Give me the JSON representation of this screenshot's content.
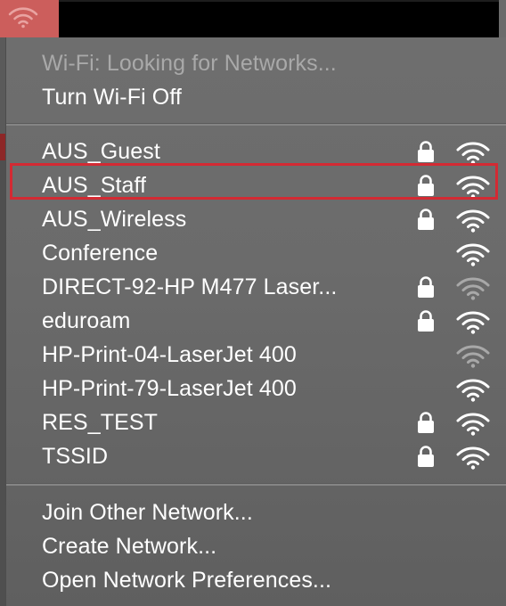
{
  "colors": {
    "menubar_active": "#cc5e5c",
    "menu_text": "#ffffff",
    "disabled_text": "#a9a9a9",
    "highlight_border": "#d32a33",
    "weak_signal": "#a8a8a8"
  },
  "menubar": {
    "wifi_icon": "wifi-icon"
  },
  "status": {
    "text": "Wi-Fi: Looking for Networks..."
  },
  "actions_top": [
    {
      "label": "Turn Wi-Fi Off"
    }
  ],
  "networks": [
    {
      "ssid": "AUS_Guest",
      "secured": true,
      "signal": "strong",
      "highlighted": false
    },
    {
      "ssid": "AUS_Staff",
      "secured": true,
      "signal": "strong",
      "highlighted": false
    },
    {
      "ssid": "AUS_Wireless",
      "secured": true,
      "signal": "strong",
      "highlighted": true
    },
    {
      "ssid": "Conference",
      "secured": false,
      "signal": "strong",
      "highlighted": false
    },
    {
      "ssid": "DIRECT-92-HP M477 Laser...",
      "secured": true,
      "signal": "weak",
      "highlighted": false
    },
    {
      "ssid": "eduroam",
      "secured": true,
      "signal": "strong",
      "highlighted": false
    },
    {
      "ssid": "HP-Print-04-LaserJet 400",
      "secured": false,
      "signal": "weak",
      "highlighted": false
    },
    {
      "ssid": "HP-Print-79-LaserJet 400",
      "secured": false,
      "signal": "strong",
      "highlighted": false
    },
    {
      "ssid": "RES_TEST",
      "secured": true,
      "signal": "strong",
      "highlighted": false
    },
    {
      "ssid": "TSSID",
      "secured": true,
      "signal": "strong",
      "highlighted": false
    }
  ],
  "actions_bottom": [
    {
      "label": "Join Other Network..."
    },
    {
      "label": "Create Network..."
    },
    {
      "label": "Open Network Preferences..."
    }
  ]
}
